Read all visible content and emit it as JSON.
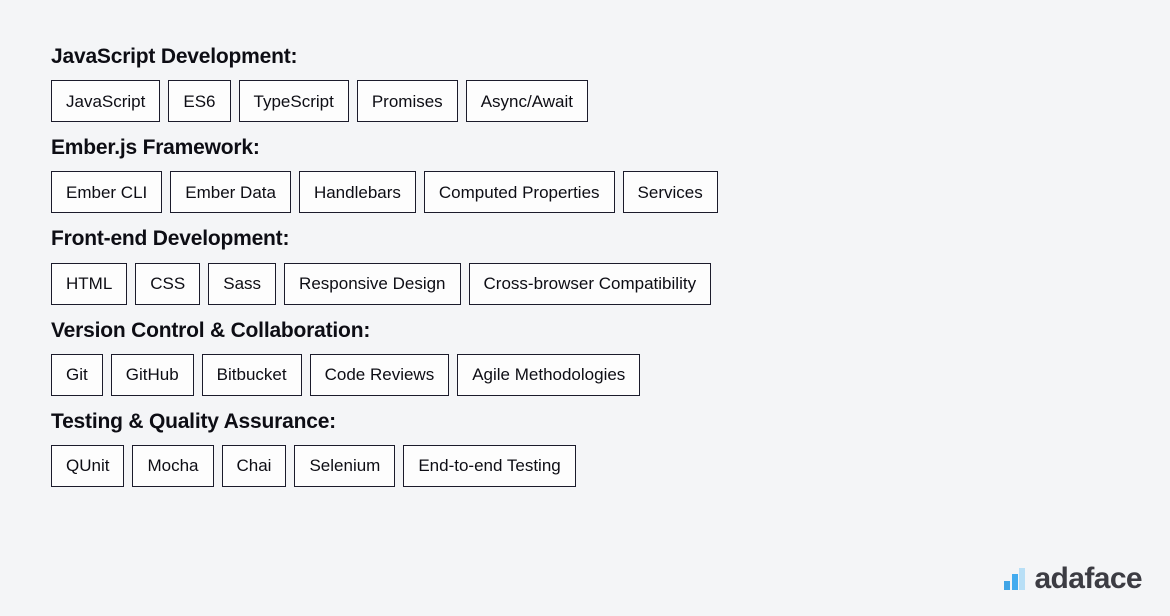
{
  "page": {
    "background_color": "#f4f5f7",
    "text_color": "#0d0d14"
  },
  "sections": [
    {
      "heading": "JavaScript Development:",
      "chips": [
        "JavaScript",
        "ES6",
        "TypeScript",
        "Promises",
        "Async/Await"
      ]
    },
    {
      "heading": "Ember.js Framework:",
      "chips": [
        "Ember CLI",
        "Ember Data",
        "Handlebars",
        "Computed Properties",
        "Services"
      ]
    },
    {
      "heading": "Front-end Development:",
      "chips": [
        "HTML",
        "CSS",
        "Sass",
        "Responsive Design",
        "Cross-browser Compatibility"
      ]
    },
    {
      "heading": "Version Control & Collaboration:",
      "chips": [
        "Git",
        "GitHub",
        "Bitbucket",
        "Code Reviews",
        "Agile Methodologies"
      ]
    },
    {
      "heading": "Testing & Quality Assurance:",
      "chips": [
        "QUnit",
        "Mocha",
        "Chai",
        "Selenium",
        "End-to-end Testing"
      ]
    }
  ],
  "brand": {
    "name": "adaface",
    "mark_icon": "bar-chart-icon",
    "mark_colors": [
      "#3fa4e6",
      "#42abef",
      "#b8dff6"
    ],
    "word_color": "#3c3c43"
  }
}
